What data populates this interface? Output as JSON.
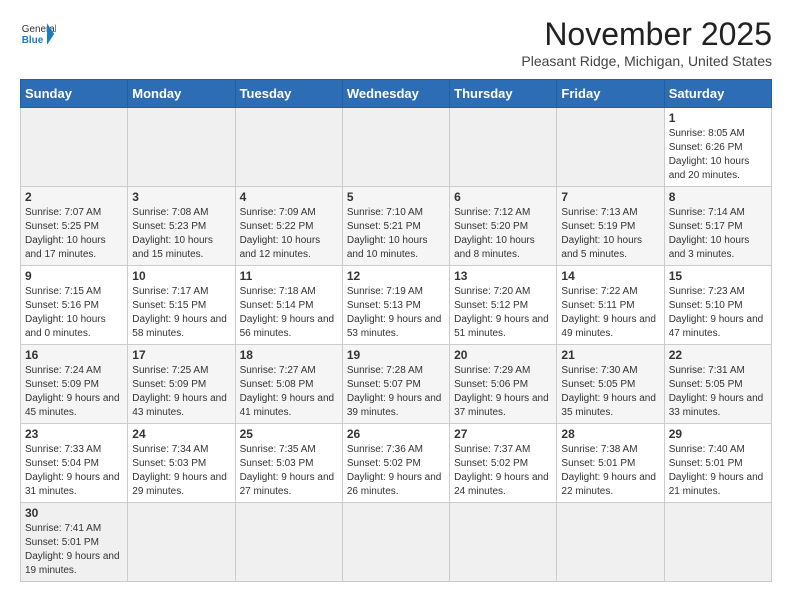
{
  "header": {
    "logo_general": "General",
    "logo_blue": "Blue",
    "month": "November 2025",
    "location": "Pleasant Ridge, Michigan, United States"
  },
  "weekdays": [
    "Sunday",
    "Monday",
    "Tuesday",
    "Wednesday",
    "Thursday",
    "Friday",
    "Saturday"
  ],
  "weeks": [
    [
      {
        "day": "",
        "info": ""
      },
      {
        "day": "",
        "info": ""
      },
      {
        "day": "",
        "info": ""
      },
      {
        "day": "",
        "info": ""
      },
      {
        "day": "",
        "info": ""
      },
      {
        "day": "",
        "info": ""
      },
      {
        "day": "1",
        "info": "Sunrise: 8:05 AM\nSunset: 6:26 PM\nDaylight: 10 hours\nand 20 minutes."
      }
    ],
    [
      {
        "day": "2",
        "info": "Sunrise: 7:07 AM\nSunset: 5:25 PM\nDaylight: 10 hours\nand 17 minutes."
      },
      {
        "day": "3",
        "info": "Sunrise: 7:08 AM\nSunset: 5:23 PM\nDaylight: 10 hours\nand 15 minutes."
      },
      {
        "day": "4",
        "info": "Sunrise: 7:09 AM\nSunset: 5:22 PM\nDaylight: 10 hours\nand 12 minutes."
      },
      {
        "day": "5",
        "info": "Sunrise: 7:10 AM\nSunset: 5:21 PM\nDaylight: 10 hours\nand 10 minutes."
      },
      {
        "day": "6",
        "info": "Sunrise: 7:12 AM\nSunset: 5:20 PM\nDaylight: 10 hours\nand 8 minutes."
      },
      {
        "day": "7",
        "info": "Sunrise: 7:13 AM\nSunset: 5:19 PM\nDaylight: 10 hours\nand 5 minutes."
      },
      {
        "day": "8",
        "info": "Sunrise: 7:14 AM\nSunset: 5:17 PM\nDaylight: 10 hours\nand 3 minutes."
      }
    ],
    [
      {
        "day": "9",
        "info": "Sunrise: 7:15 AM\nSunset: 5:16 PM\nDaylight: 10 hours\nand 0 minutes."
      },
      {
        "day": "10",
        "info": "Sunrise: 7:17 AM\nSunset: 5:15 PM\nDaylight: 9 hours\nand 58 minutes."
      },
      {
        "day": "11",
        "info": "Sunrise: 7:18 AM\nSunset: 5:14 PM\nDaylight: 9 hours\nand 56 minutes."
      },
      {
        "day": "12",
        "info": "Sunrise: 7:19 AM\nSunset: 5:13 PM\nDaylight: 9 hours\nand 53 minutes."
      },
      {
        "day": "13",
        "info": "Sunrise: 7:20 AM\nSunset: 5:12 PM\nDaylight: 9 hours\nand 51 minutes."
      },
      {
        "day": "14",
        "info": "Sunrise: 7:22 AM\nSunset: 5:11 PM\nDaylight: 9 hours\nand 49 minutes."
      },
      {
        "day": "15",
        "info": "Sunrise: 7:23 AM\nSunset: 5:10 PM\nDaylight: 9 hours\nand 47 minutes."
      }
    ],
    [
      {
        "day": "16",
        "info": "Sunrise: 7:24 AM\nSunset: 5:09 PM\nDaylight: 9 hours\nand 45 minutes."
      },
      {
        "day": "17",
        "info": "Sunrise: 7:25 AM\nSunset: 5:09 PM\nDaylight: 9 hours\nand 43 minutes."
      },
      {
        "day": "18",
        "info": "Sunrise: 7:27 AM\nSunset: 5:08 PM\nDaylight: 9 hours\nand 41 minutes."
      },
      {
        "day": "19",
        "info": "Sunrise: 7:28 AM\nSunset: 5:07 PM\nDaylight: 9 hours\nand 39 minutes."
      },
      {
        "day": "20",
        "info": "Sunrise: 7:29 AM\nSunset: 5:06 PM\nDaylight: 9 hours\nand 37 minutes."
      },
      {
        "day": "21",
        "info": "Sunrise: 7:30 AM\nSunset: 5:05 PM\nDaylight: 9 hours\nand 35 minutes."
      },
      {
        "day": "22",
        "info": "Sunrise: 7:31 AM\nSunset: 5:05 PM\nDaylight: 9 hours\nand 33 minutes."
      }
    ],
    [
      {
        "day": "23",
        "info": "Sunrise: 7:33 AM\nSunset: 5:04 PM\nDaylight: 9 hours\nand 31 minutes."
      },
      {
        "day": "24",
        "info": "Sunrise: 7:34 AM\nSunset: 5:03 PM\nDaylight: 9 hours\nand 29 minutes."
      },
      {
        "day": "25",
        "info": "Sunrise: 7:35 AM\nSunset: 5:03 PM\nDaylight: 9 hours\nand 27 minutes."
      },
      {
        "day": "26",
        "info": "Sunrise: 7:36 AM\nSunset: 5:02 PM\nDaylight: 9 hours\nand 26 minutes."
      },
      {
        "day": "27",
        "info": "Sunrise: 7:37 AM\nSunset: 5:02 PM\nDaylight: 9 hours\nand 24 minutes."
      },
      {
        "day": "28",
        "info": "Sunrise: 7:38 AM\nSunset: 5:01 PM\nDaylight: 9 hours\nand 22 minutes."
      },
      {
        "day": "29",
        "info": "Sunrise: 7:40 AM\nSunset: 5:01 PM\nDaylight: 9 hours\nand 21 minutes."
      }
    ],
    [
      {
        "day": "30",
        "info": "Sunrise: 7:41 AM\nSunset: 5:01 PM\nDaylight: 9 hours\nand 19 minutes."
      },
      {
        "day": "",
        "info": ""
      },
      {
        "day": "",
        "info": ""
      },
      {
        "day": "",
        "info": ""
      },
      {
        "day": "",
        "info": ""
      },
      {
        "day": "",
        "info": ""
      },
      {
        "day": "",
        "info": ""
      }
    ]
  ]
}
